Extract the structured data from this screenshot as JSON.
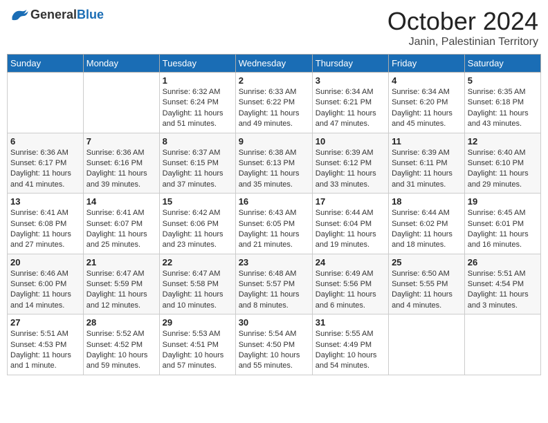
{
  "header": {
    "logo_general": "General",
    "logo_blue": "Blue",
    "month": "October 2024",
    "location": "Janin, Palestinian Territory"
  },
  "days_of_week": [
    "Sunday",
    "Monday",
    "Tuesday",
    "Wednesday",
    "Thursday",
    "Friday",
    "Saturday"
  ],
  "weeks": [
    [
      {
        "day": "",
        "info": ""
      },
      {
        "day": "",
        "info": ""
      },
      {
        "day": "1",
        "info": "Sunrise: 6:32 AM\nSunset: 6:24 PM\nDaylight: 11 hours and 51 minutes."
      },
      {
        "day": "2",
        "info": "Sunrise: 6:33 AM\nSunset: 6:22 PM\nDaylight: 11 hours and 49 minutes."
      },
      {
        "day": "3",
        "info": "Sunrise: 6:34 AM\nSunset: 6:21 PM\nDaylight: 11 hours and 47 minutes."
      },
      {
        "day": "4",
        "info": "Sunrise: 6:34 AM\nSunset: 6:20 PM\nDaylight: 11 hours and 45 minutes."
      },
      {
        "day": "5",
        "info": "Sunrise: 6:35 AM\nSunset: 6:18 PM\nDaylight: 11 hours and 43 minutes."
      }
    ],
    [
      {
        "day": "6",
        "info": "Sunrise: 6:36 AM\nSunset: 6:17 PM\nDaylight: 11 hours and 41 minutes."
      },
      {
        "day": "7",
        "info": "Sunrise: 6:36 AM\nSunset: 6:16 PM\nDaylight: 11 hours and 39 minutes."
      },
      {
        "day": "8",
        "info": "Sunrise: 6:37 AM\nSunset: 6:15 PM\nDaylight: 11 hours and 37 minutes."
      },
      {
        "day": "9",
        "info": "Sunrise: 6:38 AM\nSunset: 6:13 PM\nDaylight: 11 hours and 35 minutes."
      },
      {
        "day": "10",
        "info": "Sunrise: 6:39 AM\nSunset: 6:12 PM\nDaylight: 11 hours and 33 minutes."
      },
      {
        "day": "11",
        "info": "Sunrise: 6:39 AM\nSunset: 6:11 PM\nDaylight: 11 hours and 31 minutes."
      },
      {
        "day": "12",
        "info": "Sunrise: 6:40 AM\nSunset: 6:10 PM\nDaylight: 11 hours and 29 minutes."
      }
    ],
    [
      {
        "day": "13",
        "info": "Sunrise: 6:41 AM\nSunset: 6:08 PM\nDaylight: 11 hours and 27 minutes."
      },
      {
        "day": "14",
        "info": "Sunrise: 6:41 AM\nSunset: 6:07 PM\nDaylight: 11 hours and 25 minutes."
      },
      {
        "day": "15",
        "info": "Sunrise: 6:42 AM\nSunset: 6:06 PM\nDaylight: 11 hours and 23 minutes."
      },
      {
        "day": "16",
        "info": "Sunrise: 6:43 AM\nSunset: 6:05 PM\nDaylight: 11 hours and 21 minutes."
      },
      {
        "day": "17",
        "info": "Sunrise: 6:44 AM\nSunset: 6:04 PM\nDaylight: 11 hours and 19 minutes."
      },
      {
        "day": "18",
        "info": "Sunrise: 6:44 AM\nSunset: 6:02 PM\nDaylight: 11 hours and 18 minutes."
      },
      {
        "day": "19",
        "info": "Sunrise: 6:45 AM\nSunset: 6:01 PM\nDaylight: 11 hours and 16 minutes."
      }
    ],
    [
      {
        "day": "20",
        "info": "Sunrise: 6:46 AM\nSunset: 6:00 PM\nDaylight: 11 hours and 14 minutes."
      },
      {
        "day": "21",
        "info": "Sunrise: 6:47 AM\nSunset: 5:59 PM\nDaylight: 11 hours and 12 minutes."
      },
      {
        "day": "22",
        "info": "Sunrise: 6:47 AM\nSunset: 5:58 PM\nDaylight: 11 hours and 10 minutes."
      },
      {
        "day": "23",
        "info": "Sunrise: 6:48 AM\nSunset: 5:57 PM\nDaylight: 11 hours and 8 minutes."
      },
      {
        "day": "24",
        "info": "Sunrise: 6:49 AM\nSunset: 5:56 PM\nDaylight: 11 hours and 6 minutes."
      },
      {
        "day": "25",
        "info": "Sunrise: 6:50 AM\nSunset: 5:55 PM\nDaylight: 11 hours and 4 minutes."
      },
      {
        "day": "26",
        "info": "Sunrise: 5:51 AM\nSunset: 4:54 PM\nDaylight: 11 hours and 3 minutes."
      }
    ],
    [
      {
        "day": "27",
        "info": "Sunrise: 5:51 AM\nSunset: 4:53 PM\nDaylight: 11 hours and 1 minute."
      },
      {
        "day": "28",
        "info": "Sunrise: 5:52 AM\nSunset: 4:52 PM\nDaylight: 10 hours and 59 minutes."
      },
      {
        "day": "29",
        "info": "Sunrise: 5:53 AM\nSunset: 4:51 PM\nDaylight: 10 hours and 57 minutes."
      },
      {
        "day": "30",
        "info": "Sunrise: 5:54 AM\nSunset: 4:50 PM\nDaylight: 10 hours and 55 minutes."
      },
      {
        "day": "31",
        "info": "Sunrise: 5:55 AM\nSunset: 4:49 PM\nDaylight: 10 hours and 54 minutes."
      },
      {
        "day": "",
        "info": ""
      },
      {
        "day": "",
        "info": ""
      }
    ]
  ]
}
